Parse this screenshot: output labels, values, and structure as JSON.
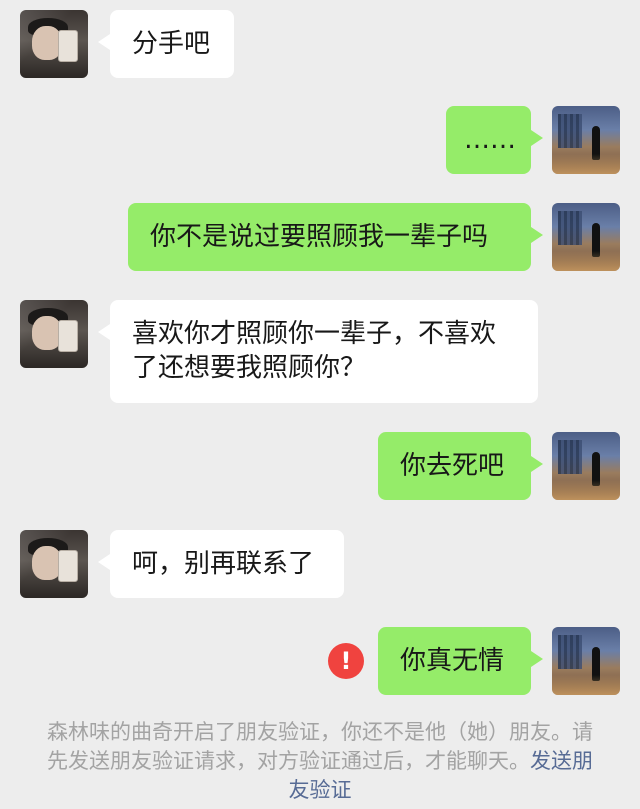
{
  "messages": [
    {
      "side": "in",
      "text": "分手吧"
    },
    {
      "side": "out",
      "text": "……"
    },
    {
      "side": "out",
      "text": "你不是说过要照顾我一辈子吗"
    },
    {
      "side": "in",
      "text": "喜欢你才照顾你一辈子，不喜欢\n了还想要我照顾你？"
    },
    {
      "side": "out",
      "text": "你去死吧"
    },
    {
      "side": "in",
      "text": "呵，别再联系了"
    },
    {
      "side": "out",
      "text": "你真无情",
      "failed": true
    }
  ],
  "failed_icon": "!",
  "system_notice": {
    "text": "森林味的曲奇开启了朋友验证，你还不是他（她）朋友。请先发送朋友验证请求，对方验证通过后，才能聊天。",
    "link_label": "发送朋友验证"
  },
  "colors": {
    "background": "#ededed",
    "incoming_bubble": "#ffffff",
    "outgoing_bubble": "#95ec69",
    "error": "#f0433f",
    "link": "#576b95"
  }
}
